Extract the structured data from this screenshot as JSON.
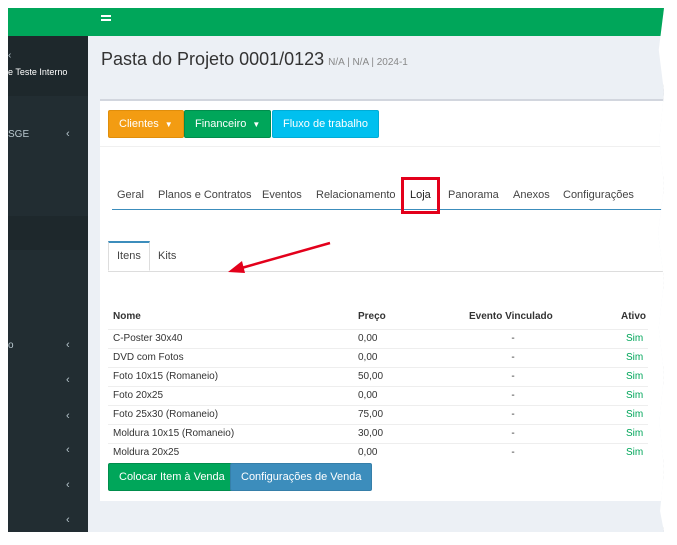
{
  "topbar": {
    "menu_icon": "hamburger-icon"
  },
  "sidebar": {
    "brand_text": "e Teste Interno",
    "items": [
      {
        "label": "",
        "chev": "‹"
      },
      {
        "label": "SGE",
        "chev": "‹"
      },
      {
        "label": "o",
        "chev": "‹"
      },
      {
        "label": "",
        "chev": "‹"
      },
      {
        "label": "",
        "chev": "‹"
      },
      {
        "label": "",
        "chev": "‹"
      },
      {
        "label": "",
        "chev": "‹"
      },
      {
        "label": "",
        "chev": "‹"
      }
    ]
  },
  "page": {
    "title": "Pasta do Projeto 0001/0123",
    "subtitle": "N/A | N/A | 2024-1"
  },
  "actions": {
    "clientes": "Clientes",
    "financeiro": "Financeiro",
    "fluxo": "Fluxo de trabalho"
  },
  "tabs": [
    "Geral",
    "Planos e Contratos",
    "Eventos",
    "Relacionamento",
    "Loja",
    "Panorama",
    "Anexos",
    "Configurações"
  ],
  "subtabs": [
    "Itens",
    "Kits"
  ],
  "table": {
    "headers": [
      "Nome",
      "Preço",
      "Evento Vinculado",
      "Ativo"
    ],
    "rows": [
      [
        "C-Poster 30x40",
        "0,00",
        "-",
        "Sim"
      ],
      [
        "DVD com Fotos",
        "0,00",
        "-",
        "Sim"
      ],
      [
        "Foto 10x15 (Romaneio)",
        "50,00",
        "-",
        "Sim"
      ],
      [
        "Foto 20x25",
        "0,00",
        "-",
        "Sim"
      ],
      [
        "Foto 25x30 (Romaneio)",
        "75,00",
        "-",
        "Sim"
      ],
      [
        "Moldura 10x15 (Romaneio)",
        "30,00",
        "-",
        "Sim"
      ],
      [
        "Moldura 20x25",
        "0,00",
        "-",
        "Sim"
      ]
    ]
  },
  "footer_buttons": {
    "colocar": "Colocar Item à Venda",
    "config": "Configurações de Venda"
  },
  "colors": {
    "green": "#00a65a",
    "orange": "#f39c12",
    "cyan": "#00c0ef",
    "blue": "#3c8dbc",
    "highlight": "#e3001b"
  }
}
